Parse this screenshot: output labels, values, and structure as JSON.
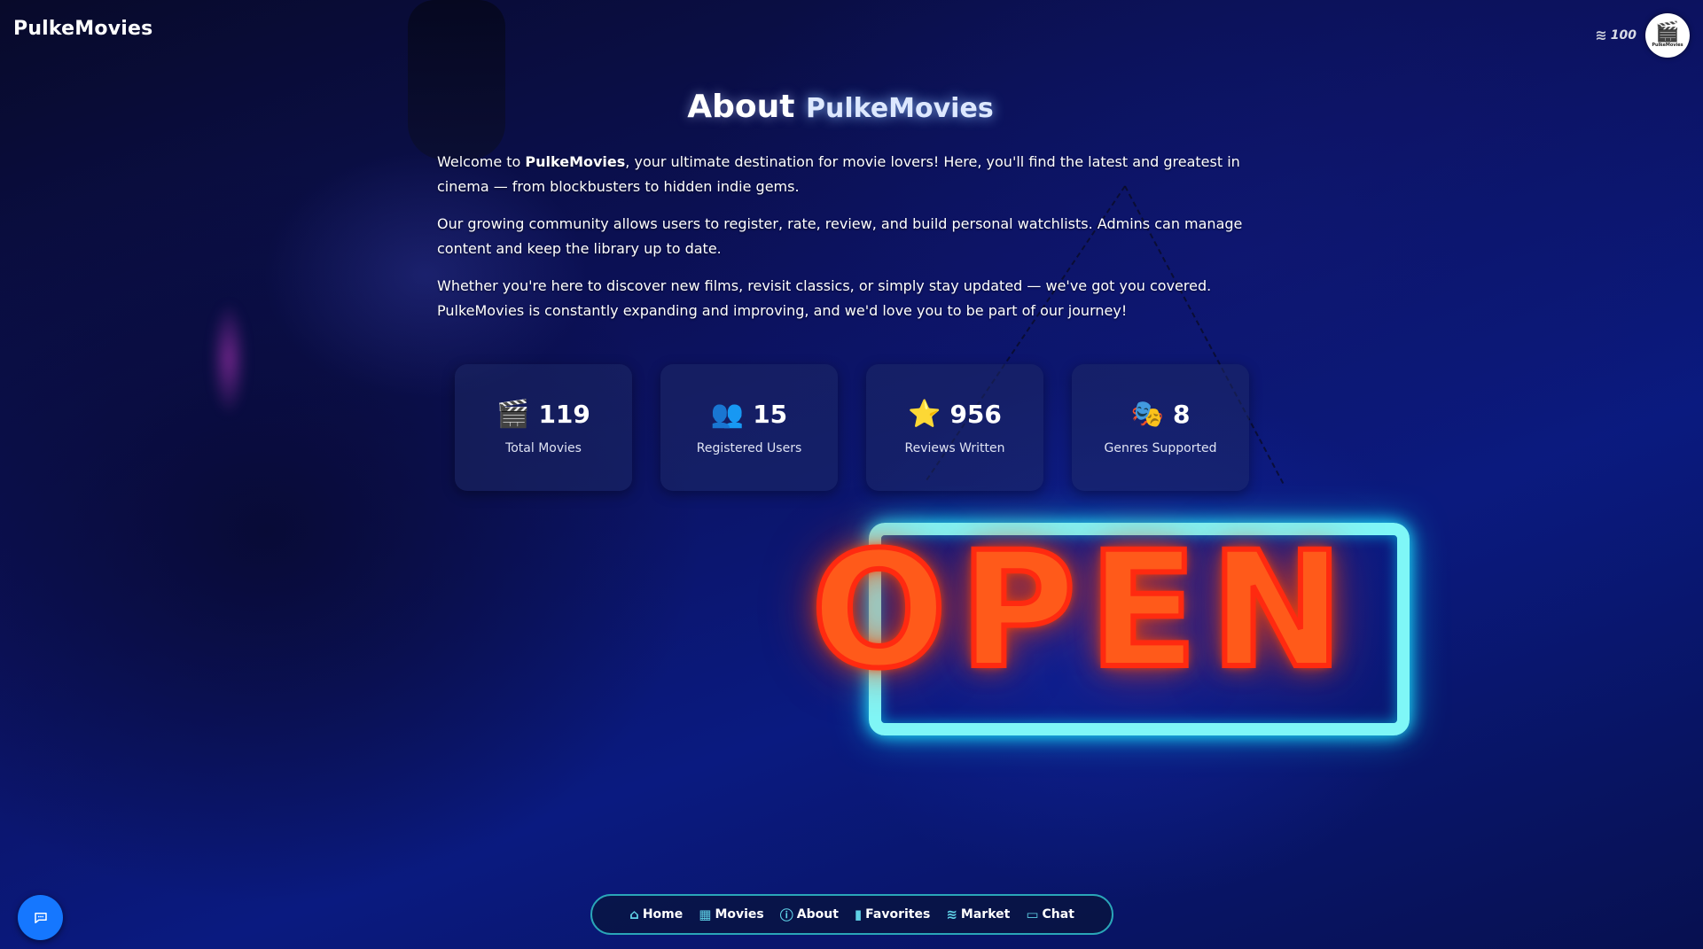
{
  "header": {
    "brand": "PulkeMovies",
    "coins": "100",
    "coin_icon": "coins-icon",
    "avatar_label": "PulkeMovies"
  },
  "about": {
    "title_prefix": "About",
    "title_accent": "PulkeMovies",
    "p1_before": "Welcome to ",
    "p1_brand": "PulkeMovies",
    "p1_after": ", your ultimate destination for movie lovers! Here, you'll find the latest and greatest in cinema — from blockbusters to hidden indie gems.",
    "p2": "Our growing community allows users to register, rate, review, and build personal watchlists. Admins can manage content and keep the library up to date.",
    "p3": "Whether you're here to discover new films, revisit classics, or simply stay updated — we've got you covered. PulkeMovies is constantly expanding and improving, and we'd love you to be part of our journey!"
  },
  "stats": [
    {
      "icon": "🎬",
      "icon_name": "clapperboard-icon",
      "value": "119",
      "label": "Total Movies"
    },
    {
      "icon": "👥",
      "icon_name": "users-icon",
      "value": "15",
      "label": "Registered Users"
    },
    {
      "icon": "⭐",
      "icon_name": "star-icon",
      "value": "956",
      "label": "Reviews Written"
    },
    {
      "icon": "🎭",
      "icon_name": "theater-masks-icon",
      "value": "8",
      "label": "Genres Supported"
    }
  ],
  "nav": [
    {
      "icon": "⌂",
      "icon_name": "home-icon",
      "label": "Home"
    },
    {
      "icon": "▦",
      "icon_name": "film-icon",
      "label": "Movies"
    },
    {
      "icon": "ⓘ",
      "icon_name": "info-icon",
      "label": "About"
    },
    {
      "icon": "▮",
      "icon_name": "bookmark-icon",
      "label": "Favorites"
    },
    {
      "icon": "≋",
      "icon_name": "coins-icon",
      "label": "Market"
    },
    {
      "icon": "▭",
      "icon_name": "chat-bubble-icon",
      "label": "Chat"
    }
  ],
  "background_sign": "OPEN",
  "colors": {
    "accent": "#1577ff",
    "nav_border": "#2aa6b8",
    "neon_orange": "#ff5a1a",
    "neon_cyan": "#7ff7f7"
  }
}
